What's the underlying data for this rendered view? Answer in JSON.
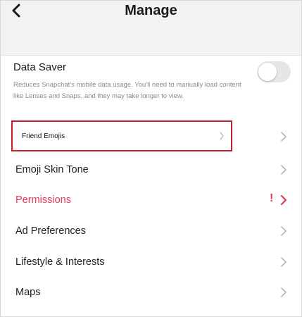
{
  "header": {
    "title": "Manage"
  },
  "data_saver": {
    "title": "Data Saver",
    "description": "Reduces Snapchat's mobile data usage. You'll need to manually load content like Lenses and Snaps, and they may take longer to view.",
    "toggle_on": false
  },
  "settings": {
    "items": [
      {
        "label": "Friend Emojis"
      },
      {
        "label": "Emoji Skin Tone"
      },
      {
        "label": "Permissions",
        "alert": "!"
      },
      {
        "label": "Ad Preferences"
      },
      {
        "label": "Lifestyle & Interests"
      },
      {
        "label": "Maps"
      }
    ]
  },
  "colors": {
    "accent_pink": "#e8385a",
    "highlight_red": "#c4202a",
    "header_bg": "#f2f2f2"
  }
}
